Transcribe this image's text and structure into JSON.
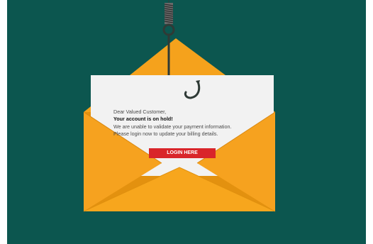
{
  "email": {
    "greeting": "Dear Valued Customer,",
    "headline": "Your account is on hold!",
    "line1": "We are unable to validate your payment information.",
    "line2": "Please login now to update your billing details.",
    "button_label": "LOGIN HERE"
  },
  "colors": {
    "background": "#0c564f",
    "envelope": "#f5a21c",
    "envelope_dark": "#e08d12",
    "paper": "#f2f2f2",
    "button": "#d9252a",
    "hook": "#2f3a36"
  },
  "icons": [
    "fishing-hook-icon",
    "envelope-icon"
  ]
}
